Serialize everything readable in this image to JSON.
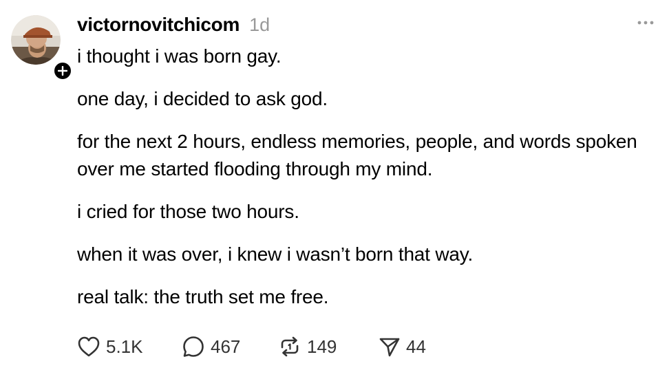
{
  "post": {
    "username": "victornovitchicom",
    "timestamp": "1d",
    "paragraphs": [
      "i thought i was born gay.",
      "one day, i decided to ask god.",
      "for the next 2 hours, endless memories, people, and words spoken over me started flooding through my mind.",
      "i cried for those two hours.",
      "when it was over, i knew i wasn’t born that way.",
      "real talk: the truth set me free."
    ]
  },
  "actions": {
    "likes": "5.1K",
    "comments": "467",
    "reposts": "149",
    "shares": "44"
  },
  "icons": {
    "like": "heart-icon",
    "comment": "comment-bubble-icon",
    "repost": "repost-icon",
    "share": "send-icon",
    "more": "more-dots-icon",
    "follow": "plus-icon"
  },
  "colors": {
    "text": "#000000",
    "muted": "#999999",
    "action_text": "#333333",
    "background": "#ffffff"
  }
}
